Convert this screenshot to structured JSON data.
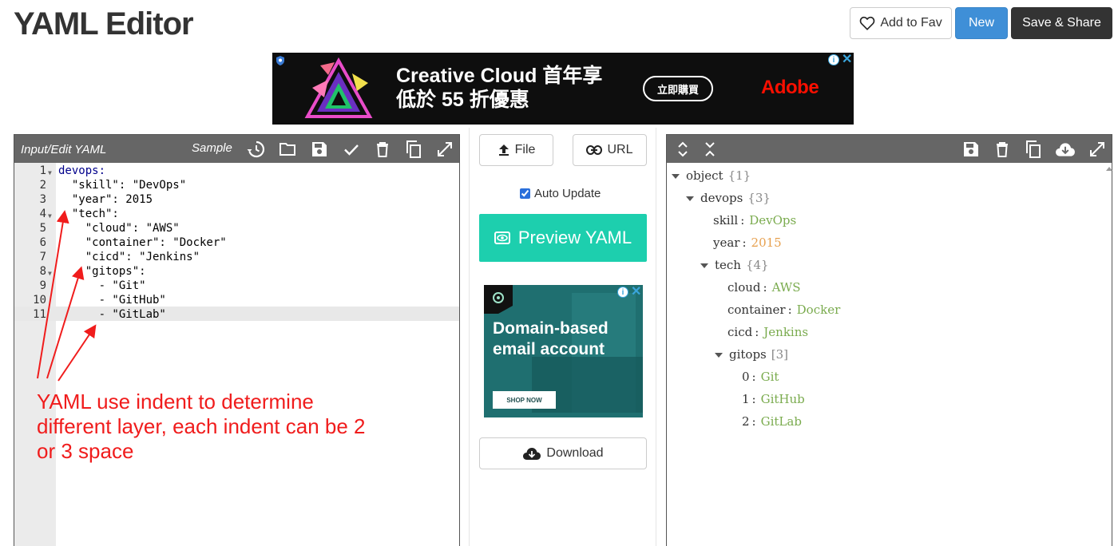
{
  "header": {
    "title": "YAML Editor",
    "fav_label": "Add to Fav",
    "new_label": "New",
    "share_label": "Save & Share"
  },
  "ad_top": {
    "line1": "Creative Cloud 首年享",
    "line2": "低於 55 折優惠",
    "cta": "立即購買",
    "brand": "Adobe"
  },
  "editor": {
    "title": "Input/Edit YAML",
    "sample_label": "Sample",
    "icons": [
      "history-icon",
      "folder-icon",
      "save-icon",
      "check-icon",
      "trash-icon",
      "copy-icon",
      "fullscreen-icon"
    ],
    "line_numbers": [
      "1",
      "2",
      "3",
      "4",
      "5",
      "6",
      "7",
      "8",
      "9",
      "10",
      "11"
    ],
    "lines": [
      "devops:",
      "  \"skill\": \"DevOps\"",
      "  \"year\": 2015",
      "  \"tech\":",
      "    \"cloud\": \"AWS\"",
      "    \"container\": \"Docker\"",
      "    \"cicd\": \"Jenkins\"",
      "    \"gitops\":",
      "      - \"Git\"",
      "      - \"GitHub\"",
      "      - \"GitLab\""
    ],
    "annotation": "YAML use indent to determine different layer, each indent can be 2 or 3 space"
  },
  "middle": {
    "file_label": "File",
    "url_label": "URL",
    "auto_update_label": "Auto Update",
    "auto_update_checked": true,
    "preview_label": "Preview YAML",
    "ad_side_text": "Domain-based email account",
    "ad_side_cta": "SHOP NOW",
    "download_label": "Download"
  },
  "viewer": {
    "icons": [
      "expand-all-icon",
      "collapse-all-icon",
      "save-icon",
      "trash-icon",
      "copy-icon",
      "cloud-download-icon",
      "fullscreen-icon"
    ],
    "tree": {
      "root": {
        "key": "object",
        "count": "{1}"
      },
      "devops": {
        "key": "devops",
        "count": "{3}"
      },
      "skill": {
        "key": "skill",
        "value": "DevOps"
      },
      "year": {
        "key": "year",
        "value": "2015"
      },
      "tech": {
        "key": "tech",
        "count": "{4}"
      },
      "cloud": {
        "key": "cloud",
        "value": "AWS"
      },
      "container": {
        "key": "container",
        "value": "Docker"
      },
      "cicd": {
        "key": "cicd",
        "value": "Jenkins"
      },
      "gitops": {
        "key": "gitops",
        "count": "[3]"
      },
      "items": [
        {
          "key": "0",
          "value": "Git"
        },
        {
          "key": "1",
          "value": "GitHub"
        },
        {
          "key": "2",
          "value": "GitLab"
        }
      ]
    }
  },
  "colors": {
    "new_button": "#3f8fd7",
    "share_button": "#333333",
    "preview_button": "#1dcfae",
    "toolbar": "#666666",
    "annotation": "#f01c1c",
    "tree_string": "#7aab4e",
    "tree_number": "#e7a04e"
  }
}
